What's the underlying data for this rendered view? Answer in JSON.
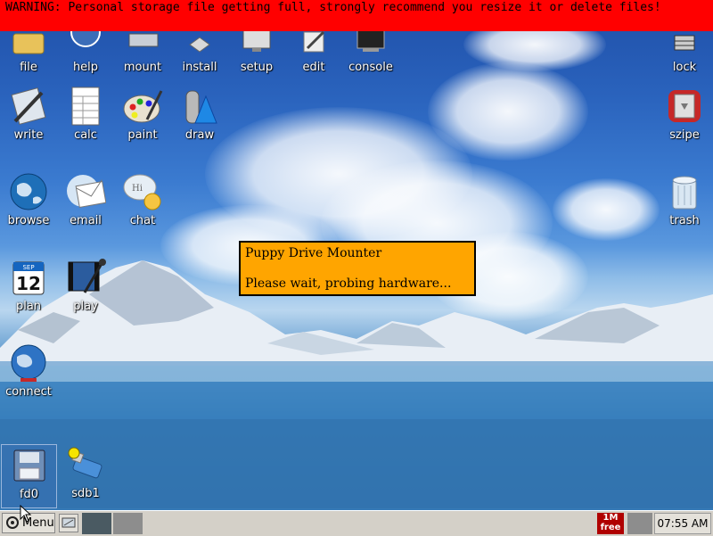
{
  "warning": {
    "text": "WARNING: Personal storage file getting full, strongly recommend you resize it or delete files!"
  },
  "desktop_icons": {
    "file": {
      "label": "file",
      "icon": "folder-icon"
    },
    "help": {
      "label": "help",
      "icon": "help-icon"
    },
    "mount": {
      "label": "mount",
      "icon": "drive-mount-icon"
    },
    "install": {
      "label": "install",
      "icon": "package-install-icon"
    },
    "setup": {
      "label": "setup",
      "icon": "monitor-setup-icon"
    },
    "edit": {
      "label": "edit",
      "icon": "text-edit-icon"
    },
    "console": {
      "label": "console",
      "icon": "terminal-icon"
    },
    "lock": {
      "label": "lock",
      "icon": "lock-icon"
    },
    "write": {
      "label": "write",
      "icon": "write-tools-icon"
    },
    "calc": {
      "label": "calc",
      "icon": "spreadsheet-icon"
    },
    "paint": {
      "label": "paint",
      "icon": "palette-icon"
    },
    "draw": {
      "label": "draw",
      "icon": "shapes-icon"
    },
    "szipe": {
      "label": "szipe",
      "icon": "archive-box-icon"
    },
    "browse": {
      "label": "browse",
      "icon": "globe-icon"
    },
    "email": {
      "label": "email",
      "icon": "envelope-icon"
    },
    "chat": {
      "label": "chat",
      "icon": "chat-bubble-icon"
    },
    "trash": {
      "label": "trash",
      "icon": "trash-bin-icon"
    },
    "plan": {
      "label": "plan",
      "icon": "calendar-icon",
      "day": "12",
      "month": "SEP"
    },
    "play": {
      "label": "play",
      "icon": "media-player-icon"
    },
    "connect": {
      "label": "connect",
      "icon": "network-globe-icon"
    },
    "fd0": {
      "label": "fd0",
      "icon": "floppy-disk-icon"
    },
    "sdb1": {
      "label": "sdb1",
      "icon": "usb-drive-icon"
    }
  },
  "dialog": {
    "title": "Puppy Drive Mounter",
    "message": "Please wait, probing hardware..."
  },
  "taskbar": {
    "menu_label": "Menu",
    "free_top": "1M",
    "free_bottom": "free",
    "clock": "07:55 AM"
  },
  "colors": {
    "warning_bg": "#ff0000",
    "dialog_bg": "#ffa500",
    "taskbar_bg": "#d4d0c8"
  }
}
